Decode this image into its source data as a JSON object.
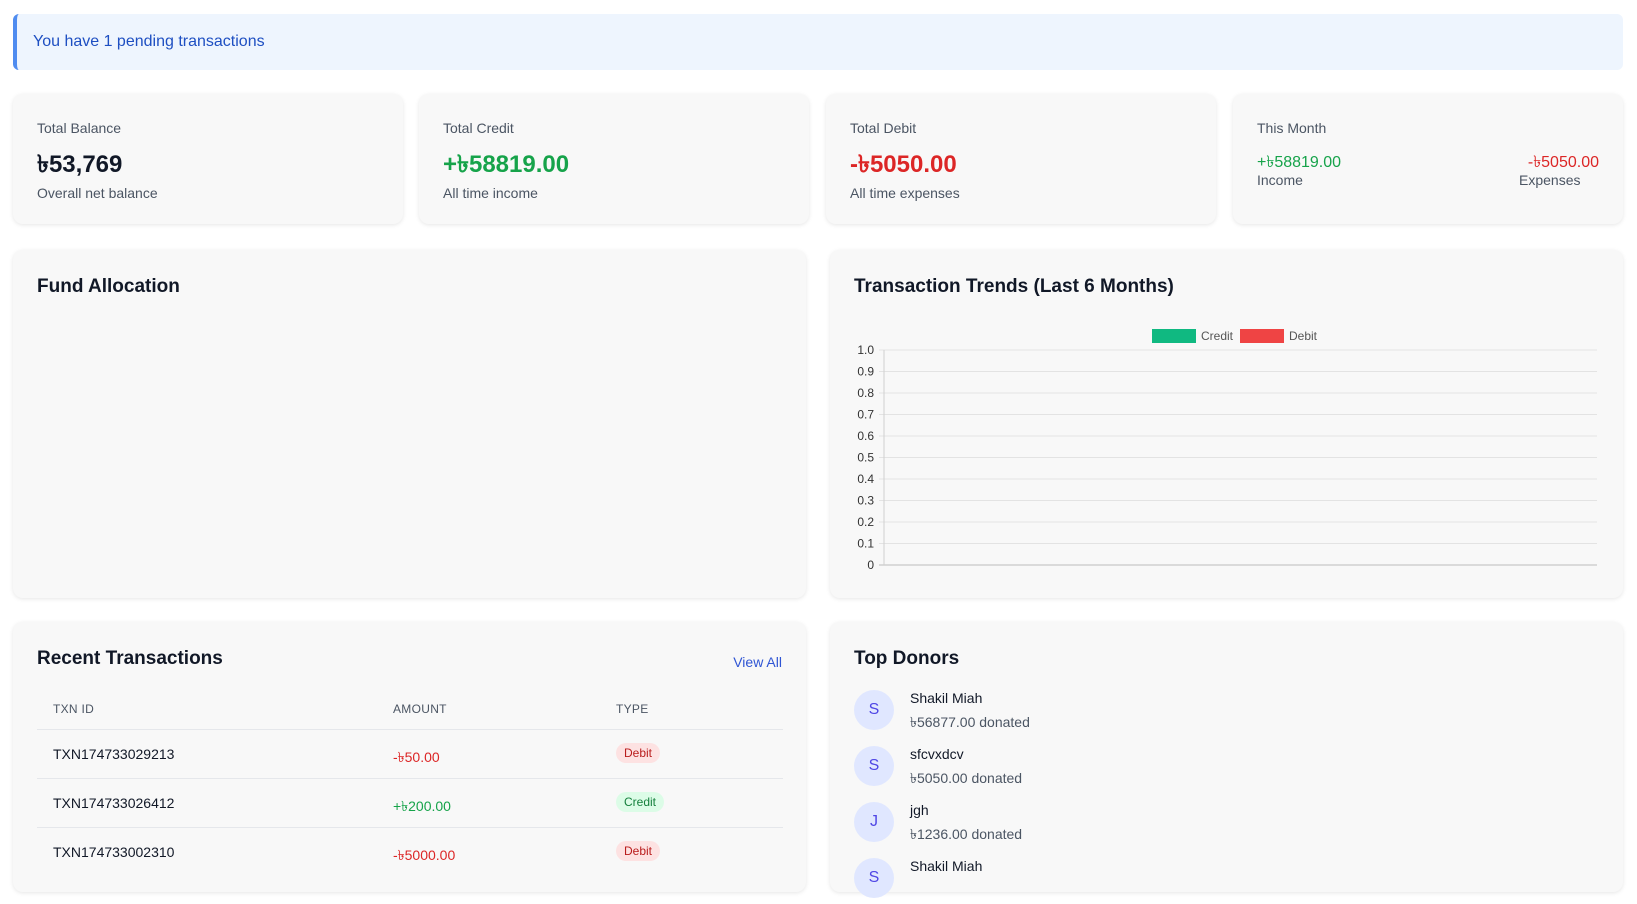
{
  "alert": {
    "text": "You have 1 pending transactions"
  },
  "stats": {
    "balance": {
      "label": "Total Balance",
      "value": "৳53,769",
      "sub": "Overall net balance"
    },
    "credit": {
      "label": "Total Credit",
      "value": "+৳58819.00",
      "sub": "All time income"
    },
    "debit": {
      "label": "Total Debit",
      "value": "-৳5050.00",
      "sub": "All time expenses"
    },
    "month": {
      "label": "This Month",
      "income_value": "+৳58819.00",
      "income_label": "Income",
      "expense_value": "-৳5050.00",
      "expense_label": "Expenses"
    }
  },
  "fund_allocation": {
    "title": "Fund Allocation"
  },
  "trends": {
    "title": "Transaction Trends (Last 6 Months)",
    "colors": {
      "credit": "#10b981",
      "debit": "#ef4444"
    }
  },
  "chart_data": {
    "type": "bar",
    "title": "Transaction Trends (Last 6 Months)",
    "legend_position": "top-center",
    "series": [
      {
        "name": "Credit",
        "values": []
      },
      {
        "name": "Debit",
        "values": []
      }
    ],
    "categories": [],
    "ylim": [
      0,
      1.0
    ],
    "y_ticks": [
      "1.0",
      "0.9",
      "0.8",
      "0.7",
      "0.6",
      "0.5",
      "0.4",
      "0.3",
      "0.2",
      "0.1",
      "0"
    ],
    "grid": true
  },
  "recent": {
    "title": "Recent Transactions",
    "view_all": "View All",
    "headers": [
      "TXN ID",
      "AMOUNT",
      "TYPE"
    ],
    "rows": [
      {
        "id": "TXN174733029213",
        "amount": "-৳50.00",
        "type": "Debit"
      },
      {
        "id": "TXN174733026412",
        "amount": "+৳200.00",
        "type": "Credit"
      },
      {
        "id": "TXN174733002310",
        "amount": "-৳5000.00",
        "type": "Debit"
      }
    ]
  },
  "donors": {
    "title": "Top Donors",
    "items": [
      {
        "initial": "S",
        "name": "Shakil Miah",
        "amount": "৳56877.00 donated"
      },
      {
        "initial": "S",
        "name": "sfcvxdcv",
        "amount": "৳5050.00 donated"
      },
      {
        "initial": "J",
        "name": "jgh",
        "amount": "৳1236.00 donated"
      },
      {
        "initial": "S",
        "name": "Shakil Miah",
        "amount": ""
      }
    ]
  }
}
